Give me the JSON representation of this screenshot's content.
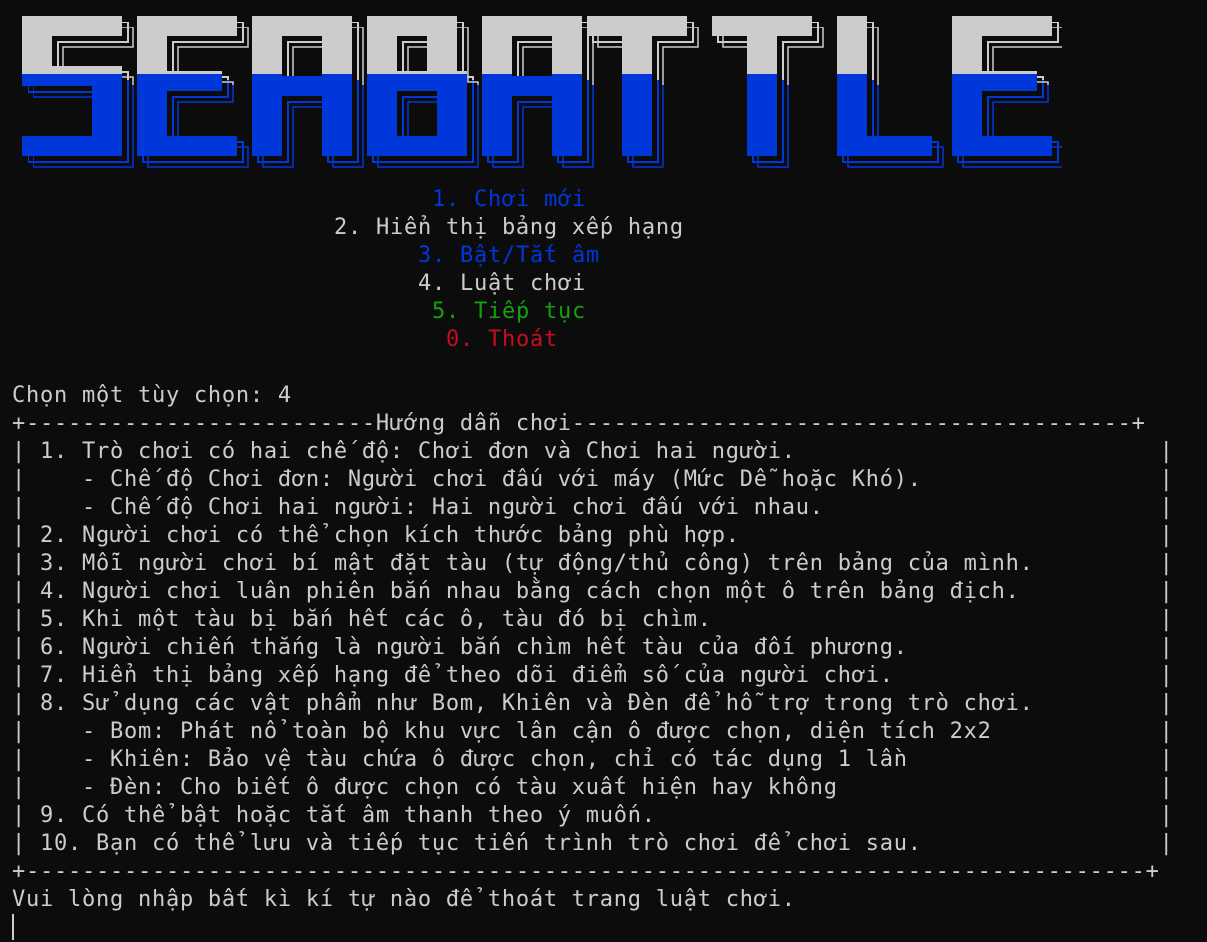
{
  "colors": {
    "background": "#0c0c0c",
    "text": "#cccccc",
    "logo_top": "#cccccc",
    "logo_bottom": "#0037da",
    "blue": "#0037da",
    "green": "#13a10e",
    "red": "#c50f1f"
  },
  "logo": {
    "text": "SEABATTLE"
  },
  "menu": [
    {
      "label": "1. Chơi mới",
      "color": "#0037da"
    },
    {
      "label": "2. Hiển thị bảng xếp hạng",
      "color": "#cccccc"
    },
    {
      "label": "3. Bật/Tắt âm",
      "color": "#0037da"
    },
    {
      "label": "4. Luật chơi",
      "color": "#cccccc"
    },
    {
      "label": "5. Tiếp tục",
      "color": "#13a10e"
    },
    {
      "label": "0. Thoát",
      "color": "#c50f1f"
    }
  ],
  "prompt": "Chọn một tùy chọn: 4",
  "rules": {
    "top_border": "+-------------------------Hướng dẫn chơi----------------------------------------+",
    "lines": [
      "| 1. Trò chơi có hai chế độ: Chơi đơn và Chơi hai người.                          |",
      "|    - Chế độ Chơi đơn: Người chơi đấu với máy (Mức Dễ hoặc Khó).                 |",
      "|    - Chế độ Chơi hai người: Hai người chơi đấu với nhau.                        |",
      "| 2. Người chơi có thể chọn kích thước bảng phù hợp.                              |",
      "| 3. Mỗi người chơi bí mật đặt tàu (tự động/thủ công) trên bảng của mình.         |",
      "| 4. Người chơi luân phiên bắn nhau bằng cách chọn một ô trên bảng địch.          |",
      "| 5. Khi một tàu bị bắn hết các ô, tàu đó bị chìm.                                |",
      "| 6. Người chiến thắng là người bắn chìm hết tàu của đối phương.                  |",
      "| 7. Hiển thị bảng xếp hạng để theo dõi điểm số của người chơi.                   |",
      "| 8. Sử dụng các vật phẩm như Bom, Khiên và Đèn để hỗ trợ trong trò chơi.         |",
      "|    - Bom: Phát nổ toàn bộ khu vực lân cận ô được chọn, diện tích 2x2            |",
      "|    - Khiên: Bảo vệ tàu chứa ô được chọn, chỉ có tác dụng 1 lần                  |",
      "|    - Đèn: Cho biết ô được chọn có tàu xuất hiện hay không                       |",
      "| 9. Có thể bật hoặc tắt âm thanh theo ý muốn.                                    |",
      "| 10. Bạn có thể lưu và tiếp tục tiến trình trò chơi để chơi sau.                 |"
    ],
    "bottom_border": "+--------------------------------------------------------------------------------+"
  },
  "exit_prompt": "Vui lòng nhập bất kì kí tự nào để thoát trang luật chơi."
}
